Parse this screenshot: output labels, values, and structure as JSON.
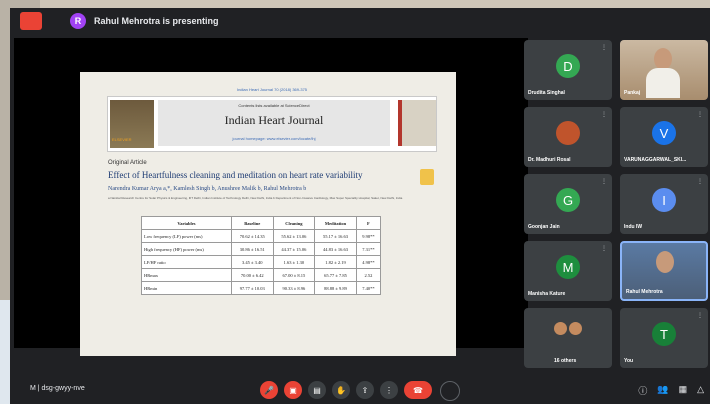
{
  "top_bar": {
    "presenter_initial": "R",
    "presenting_text": "Rahul Mehrotra is presenting"
  },
  "slide": {
    "journal_header_line": "Indian Heart Journal 70 (2018) 369-375",
    "contents_line": "Contents lists available at ScienceDirect",
    "journal_name": "Indian Heart Journal",
    "homepage_line": "journal homepage: www.elsevier.com/locate/ihj",
    "publisher_label": "ELSEVIER",
    "article_type": "Original Article",
    "title": "Effect of Heartfulness cleaning and meditation on heart rate variability",
    "authors": "Narendra Kumar Arya a,*, Kamlesh Singh b, Anushree Malik b, Rahul Mehrotra b",
    "affiliation": "a Nainital Research Centre for Solar Physics & Engineering, IIIT Delhi, Indian Institute of Technology Delhi, New Delhi, India b Department of Non-Invasive Cardiology, Max Super Speciality Hospital, Saket, New Delhi, India",
    "table": {
      "headers": [
        "Variables",
        "Baseline",
        "Cleaning",
        "Meditation",
        "F"
      ],
      "rows": [
        [
          "Low frequency (LF) power (ms)",
          "70.62 ± 14.35",
          "55.62 ± 13.06",
          "55.17 ± 16.63",
          "9.98**"
        ],
        [
          "High frequency (HF) power (ms)",
          "30.86 ± 16.51",
          "44.37 ± 15.06",
          "44.83 ± 16.63",
          "7.31**"
        ],
        [
          "LF/HF ratio",
          "3.45 ± 3.40",
          "1.63 ± 1.30",
          "1.82 ± 2.19",
          "4.98**"
        ],
        [
          "HRmax",
          "70.00 ± 6.42",
          "67.00 ± 8.15",
          "65.77 ± 7.85",
          "2.52"
        ],
        [
          "HRmin",
          "97.77 ± 10.03",
          "90.33 ± 8.96",
          "88.88 ± 9.89",
          "7.40**"
        ]
      ]
    }
  },
  "participants": [
    {
      "name": "Drudita Singhal",
      "initial": "D",
      "color": "#34a853"
    },
    {
      "name": "Pankaj",
      "initial": "",
      "color": "",
      "photo": true
    },
    {
      "name": "Dr. Madhuri Rosal",
      "initial": "",
      "color": "",
      "photo_avatar": true
    },
    {
      "name": "VARUNAGGARWAL_SKI...",
      "initial": "V",
      "color": "#1a73e8"
    },
    {
      "name": "Goonjan Jain",
      "initial": "G",
      "color": "#34a853"
    },
    {
      "name": "Indu IW",
      "initial": "I",
      "color": "#5b8def"
    },
    {
      "name": "Manisha Kature",
      "initial": "M",
      "color": "#1e8e3e"
    },
    {
      "name": "Rahul Mehrotra",
      "initial": "",
      "color": "",
      "photo": true
    },
    {
      "name": "16 others",
      "initial": "",
      "color": "",
      "group": true
    },
    {
      "name": "You",
      "initial": "T",
      "color": "#188038"
    }
  ],
  "bottom_bar": {
    "meeting_code": "M | dsg-gwyy-nve"
  },
  "colors": {
    "background": "#202124",
    "tile": "#3c4043",
    "danger": "#ea4335"
  }
}
